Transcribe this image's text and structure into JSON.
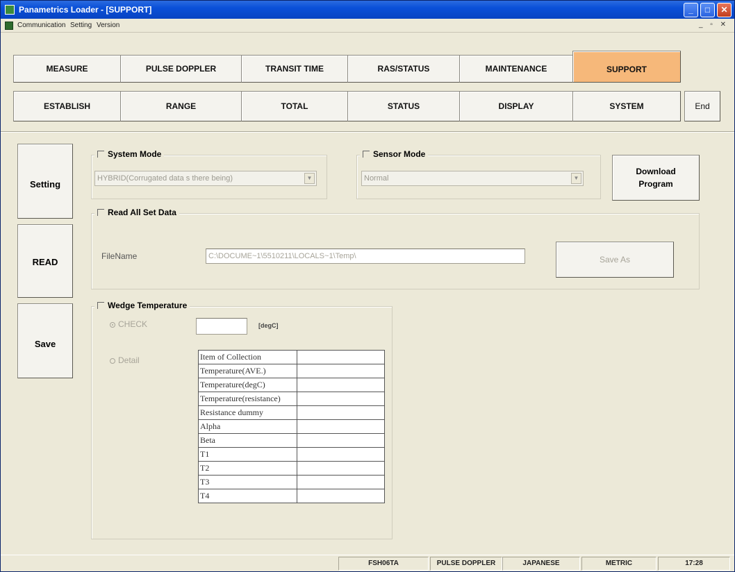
{
  "window": {
    "title": "Panametrics Loader - [SUPPORT]",
    "controls": {
      "minimize": "_",
      "maximize": "□",
      "close": "✕"
    }
  },
  "menubar": {
    "items": [
      "Communication",
      "Setting",
      "Version"
    ],
    "mdi_controls": "_ ▫ ✕"
  },
  "tabs": {
    "row1": [
      "MEASURE",
      "PULSE DOPPLER",
      "TRANSIT TIME",
      "RAS/STATUS",
      "MAINTENANCE",
      "SUPPORT"
    ],
    "row2": [
      "ESTABLISH",
      "RANGE",
      "TOTAL",
      "STATUS",
      "DISPLAY",
      "SYSTEM"
    ],
    "active": "SUPPORT",
    "end_label": "End"
  },
  "side_buttons": {
    "setting": "Setting",
    "read": "READ",
    "save": "Save"
  },
  "system_mode": {
    "label": "System Mode",
    "value": "HYBRID(Corrugated data s there being)"
  },
  "sensor_mode": {
    "label": "Sensor Mode",
    "value": "Normal"
  },
  "download_button": {
    "line1": "Download",
    "line2": "Program"
  },
  "read_all": {
    "label": "Read All Set Data",
    "filename_label": "FileName",
    "filename_value": "C:\\DOCUME~1\\5510211\\LOCALS~1\\Temp\\",
    "save_as": "Save As"
  },
  "wedge": {
    "label": "Wedge Temperature",
    "check_label": "CHECK",
    "unit": "[degC]",
    "detail_label": "Detail",
    "table_rows": [
      [
        "Item of Collection",
        ""
      ],
      [
        "Temperature(AVE.)",
        ""
      ],
      [
        "Temperature(degC)",
        ""
      ],
      [
        "Temperature(resistance)",
        ""
      ],
      [
        "Resistance dummy",
        ""
      ],
      [
        "Alpha",
        ""
      ],
      [
        "Beta",
        ""
      ],
      [
        "T1",
        ""
      ],
      [
        "T2",
        ""
      ],
      [
        "T3",
        ""
      ],
      [
        "T4",
        ""
      ]
    ]
  },
  "statusbar": {
    "cells": [
      "FSH06TA",
      "PULSE DOPPLER",
      "JAPANESE",
      "METRIC",
      "17:28"
    ]
  },
  "colors": {
    "active_tab": "#f6b87a",
    "titlebar": "#0a50d8"
  }
}
